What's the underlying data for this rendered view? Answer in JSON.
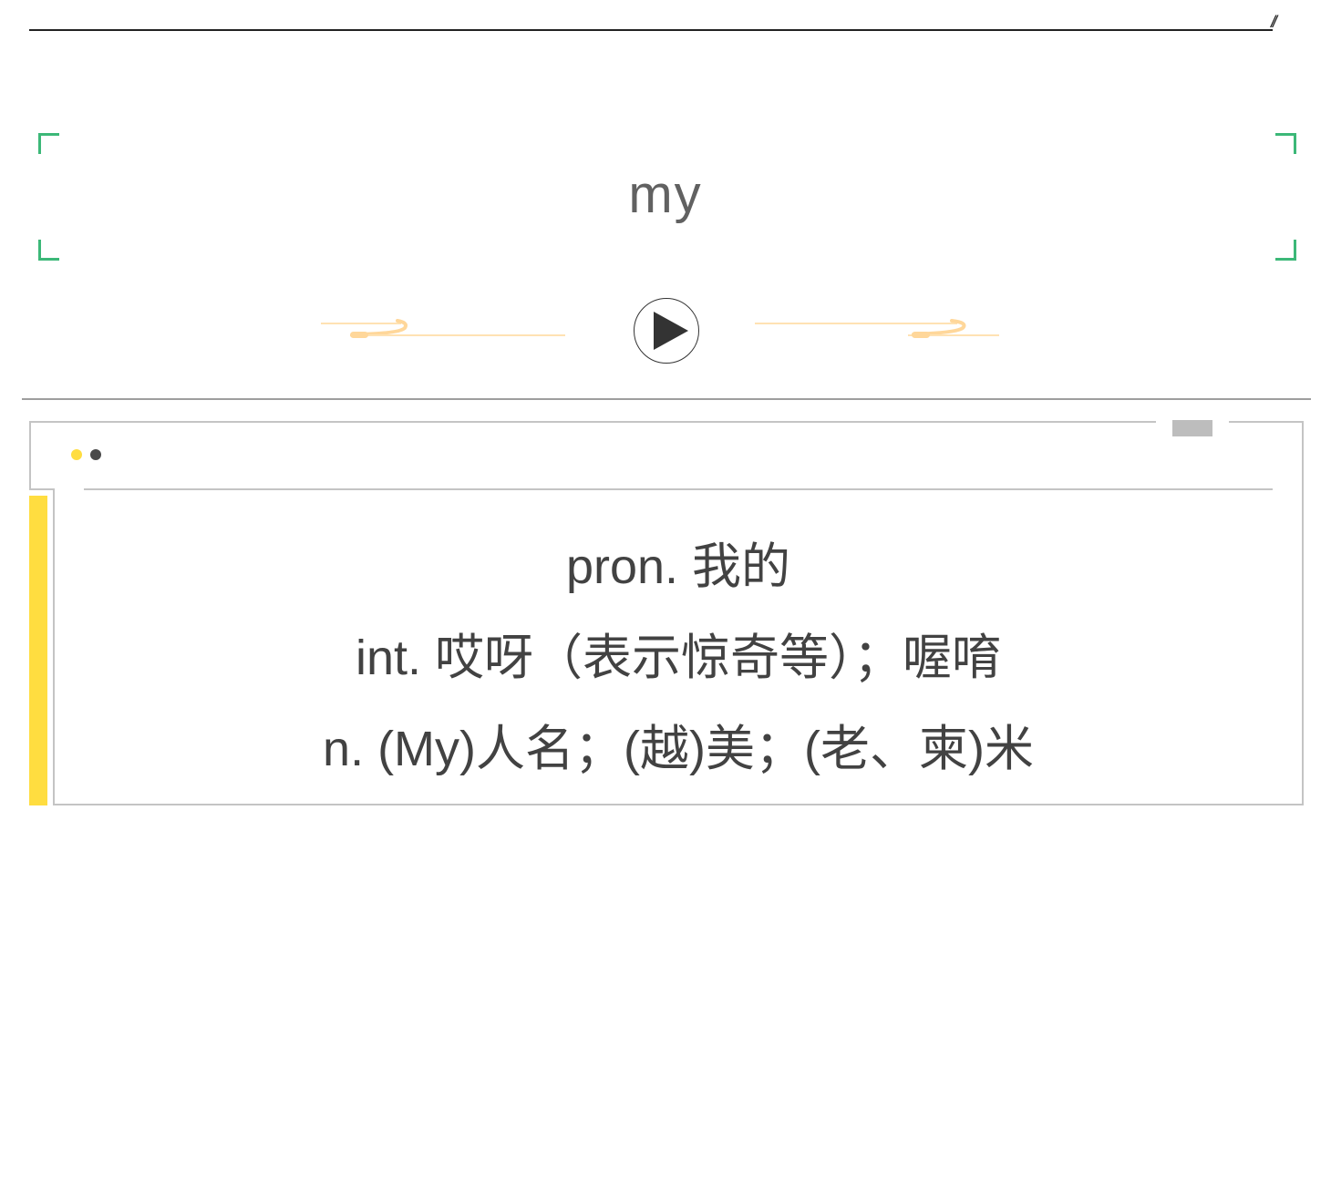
{
  "header": {
    "rule_mark": "//"
  },
  "word": {
    "headword": "my"
  },
  "colors": {
    "corner_accent": "#3cb878",
    "ornament": "#ffd79a",
    "card_accent": "#ffdd40",
    "text": "#424242"
  },
  "audio": {
    "play_icon": "play-icon"
  },
  "meanings": {
    "lines": [
      "pron. 我的",
      "int. 哎呀（表示惊奇等）；喔唷",
      "n. (My)人名；(越)美；(老、柬)米"
    ]
  }
}
